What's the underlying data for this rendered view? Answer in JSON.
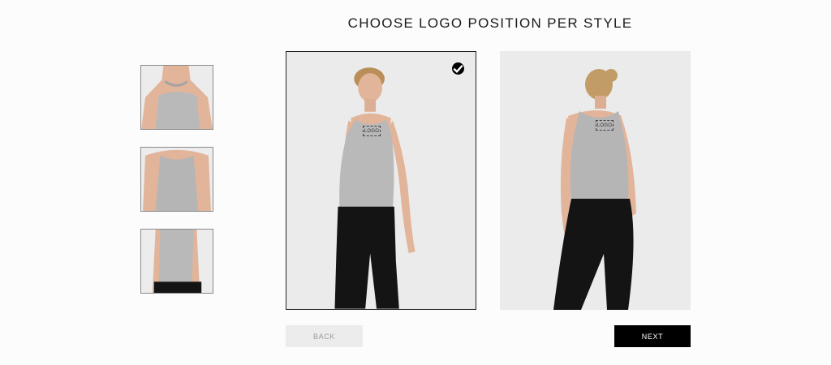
{
  "page": {
    "title": "CHOOSE LOGO POSITION PER STYLE"
  },
  "thumbnails": [
    {
      "name": "thumb-shoulder-detail"
    },
    {
      "name": "thumb-back-view"
    },
    {
      "name": "thumb-side-view"
    }
  ],
  "panels": {
    "front": {
      "logo_label": "LOGO",
      "selected": true
    },
    "back": {
      "logo_label": "LOGO",
      "selected": false
    }
  },
  "buttons": {
    "back_label": "BACK",
    "next_label": "NEXT"
  },
  "colors": {
    "background": "#fcfcfc",
    "panel": "#ebebeb",
    "accent": "#000000",
    "tank": "#b9b9b9",
    "leggings": "#141414",
    "skin": "#e2b49a"
  }
}
